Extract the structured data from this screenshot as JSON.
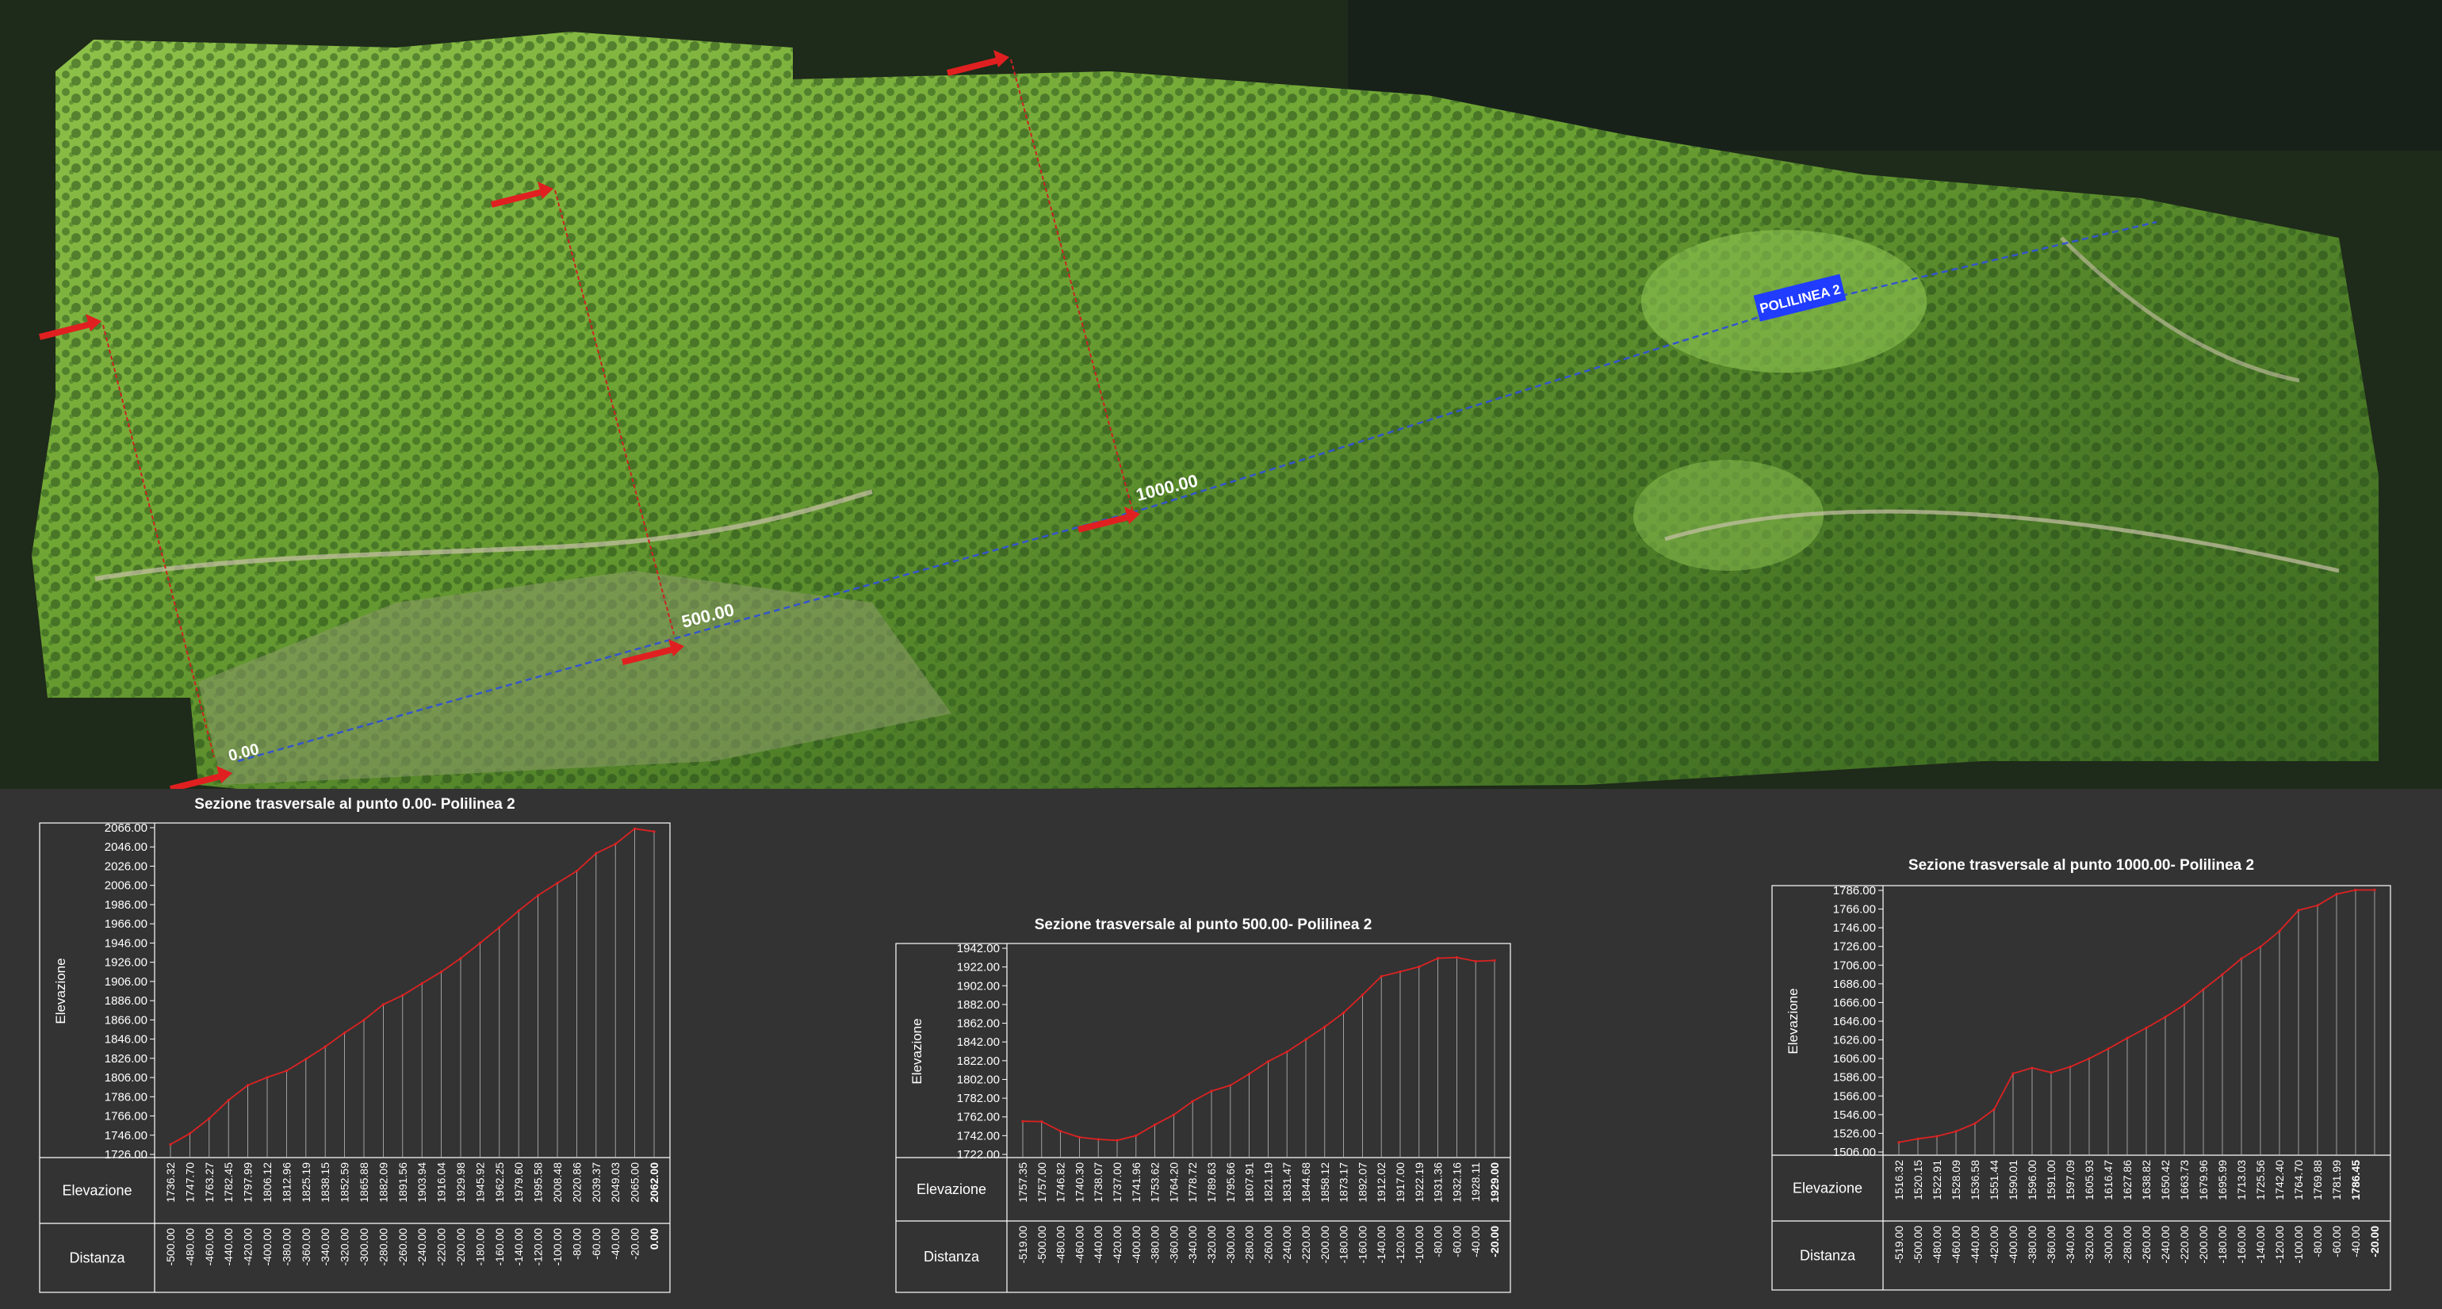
{
  "map": {
    "polyline_label": "POLILINEA 2",
    "station_labels": [
      "0.00",
      "500.00",
      "1000.00"
    ],
    "colors": {
      "background": "#333333",
      "terrain_light": "#7bb33e",
      "terrain_dark": "#2e4d1c",
      "forest_edge": "#1e2a1a",
      "polyline": "#3355cc",
      "label_bg": "#1f3cff",
      "section_line": "#cc2222",
      "arrow": "#e02020"
    }
  },
  "chart_data": [
    {
      "type": "line",
      "title": "Sezione trasversale al punto 0.00- Polilinea 2",
      "ylabel": "Elevazione",
      "row_labels": [
        "Elevazione",
        "Distanza"
      ],
      "ylim": [
        1726,
        2066
      ],
      "yticks": [
        "1726.00",
        "1746.00",
        "1766.00",
        "1786.00",
        "1806.00",
        "1826.00",
        "1846.00",
        "1866.00",
        "1886.00",
        "1906.00",
        "1926.00",
        "1946.00",
        "1966.00",
        "1986.00",
        "2006.00",
        "2026.00",
        "2046.00",
        "2066.00"
      ],
      "x": [
        -500,
        -480,
        -460,
        -440,
        -420,
        -400,
        -380,
        -360,
        -340,
        -320,
        -300,
        -280,
        -260,
        -240,
        -220,
        -200,
        -180,
        -160,
        -140,
        -120,
        -100,
        -80,
        -60,
        -40,
        -20,
        0
      ],
      "values": [
        1736.32,
        1747.7,
        1763.27,
        1782.45,
        1797.99,
        1806.12,
        1812.96,
        1825.19,
        1838.15,
        1852.59,
        1865.88,
        1882.09,
        1891.56,
        1903.94,
        1916.04,
        1929.98,
        1945.92,
        1962.25,
        1979.6,
        1995.58,
        2008.48,
        2020.86,
        2039.37,
        2049.03,
        2065.0,
        2062.0
      ],
      "elev_labels": [
        "1736.32",
        "1747.70",
        "1763.27",
        "1782.45",
        "1797.99",
        "1806.12",
        "1812.96",
        "1825.19",
        "1838.15",
        "1852.59",
        "1865.88",
        "1882.09",
        "1891.56",
        "1903.94",
        "1916.04",
        "1929.98",
        "1945.92",
        "1962.25",
        "1979.60",
        "1995.58",
        "2008.48",
        "2020.86",
        "2039.37",
        "2049.03",
        "2065.00",
        "2062.00"
      ],
      "dist_labels": [
        "-500.00",
        "-480.00",
        "-460.00",
        "-440.00",
        "-420.00",
        "-400.00",
        "-380.00",
        "-360.00",
        "-340.00",
        "-320.00",
        "-300.00",
        "-280.00",
        "-260.00",
        "-240.00",
        "-220.00",
        "-200.00",
        "-180.00",
        "-160.00",
        "-140.00",
        "-120.00",
        "-100.00",
        "-80.00",
        "-60.00",
        "-40.00",
        "-20.00",
        "0.00"
      ]
    },
    {
      "type": "line",
      "title": "Sezione trasversale al punto 500.00- Polilinea 2",
      "ylabel": "Elevazione",
      "row_labels": [
        "Elevazione",
        "Distanza"
      ],
      "ylim": [
        1722,
        1942
      ],
      "yticks": [
        "1722.00",
        "1742.00",
        "1762.00",
        "1782.00",
        "1802.00",
        "1822.00",
        "1842.00",
        "1862.00",
        "1882.00",
        "1902.00",
        "1922.00",
        "1942.00"
      ],
      "x": [
        -519,
        -500,
        -480,
        -460,
        -440,
        -420,
        -400,
        -380,
        -360,
        -340,
        -320,
        -300,
        -280,
        -260,
        -240,
        -220,
        -200,
        -180,
        -160,
        -140,
        -120,
        -100,
        -80,
        -60,
        -40,
        -20
      ],
      "values": [
        1757.35,
        1757.0,
        1746.82,
        1740.3,
        1738.07,
        1737.0,
        1741.96,
        1753.62,
        1764.2,
        1778.72,
        1789.63,
        1795.66,
        1807.91,
        1821.19,
        1831.47,
        1844.68,
        1858.12,
        1873.17,
        1892.07,
        1912.02,
        1917.0,
        1922.19,
        1931.36,
        1932.16,
        1928.11,
        1929.0
      ],
      "elev_labels": [
        "1757.35",
        "1757.00",
        "1746.82",
        "1740.30",
        "1738.07",
        "1737.00",
        "1741.96",
        "1753.62",
        "1764.20",
        "1778.72",
        "1789.63",
        "1795.66",
        "1807.91",
        "1821.19",
        "1831.47",
        "1844.68",
        "1858.12",
        "1873.17",
        "1892.07",
        "1912.02",
        "1917.00",
        "1922.19",
        "1931.36",
        "1932.16",
        "1928.11",
        "1929.00"
      ],
      "dist_labels": [
        "-519.00",
        "-500.00",
        "-480.00",
        "-460.00",
        "-440.00",
        "-420.00",
        "-400.00",
        "-380.00",
        "-360.00",
        "-340.00",
        "-320.00",
        "-300.00",
        "-280.00",
        "-260.00",
        "-240.00",
        "-220.00",
        "-200.00",
        "-180.00",
        "-160.00",
        "-140.00",
        "-120.00",
        "-100.00",
        "-80.00",
        "-60.00",
        "-40.00",
        "-20.00"
      ]
    },
    {
      "type": "line",
      "title": "Sezione trasversale al punto 1000.00- Polilinea 2",
      "ylabel": "Elevazione",
      "row_labels": [
        "Elevazione",
        "Distanza"
      ],
      "ylim": [
        1506,
        1786
      ],
      "yticks": [
        "1506.00",
        "1526.00",
        "1546.00",
        "1566.00",
        "1586.00",
        "1606.00",
        "1626.00",
        "1646.00",
        "1666.00",
        "1686.00",
        "1706.00",
        "1726.00",
        "1746.00",
        "1766.00",
        "1786.00"
      ],
      "x": [
        -519,
        -500,
        -480,
        -460,
        -440,
        -420,
        -400,
        -380,
        -360,
        -340,
        -320,
        -300,
        -280,
        -260,
        -240,
        -220,
        -200,
        -180,
        -160,
        -140,
        -120,
        -100,
        -80,
        -60,
        -40,
        -20
      ],
      "values": [
        1516.32,
        1520.15,
        1522.91,
        1528.09,
        1536.58,
        1551.44,
        1590.01,
        1596.0,
        1591.0,
        1597.09,
        1605.93,
        1616.47,
        1627.86,
        1638.82,
        1650.42,
        1663.73,
        1679.96,
        1695.99,
        1713.03,
        1725.56,
        1742.4,
        1764.7,
        1769.88,
        1781.99,
        1786.45,
        1786.45
      ],
      "elev_labels": [
        "1516.32",
        "1520.15",
        "1522.91",
        "1528.09",
        "1536.58",
        "1551.44",
        "1590.01",
        "1596.00",
        "1591.00",
        "1597.09",
        "1605.93",
        "1616.47",
        "1627.86",
        "1638.82",
        "1650.42",
        "1663.73",
        "1679.96",
        "1695.99",
        "1713.03",
        "1725.56",
        "1742.40",
        "1764.70",
        "1769.88",
        "1781.99",
        "1786.45"
      ],
      "dist_labels": [
        "-519.00",
        "-500.00",
        "-480.00",
        "-460.00",
        "-440.00",
        "-420.00",
        "-400.00",
        "-380.00",
        "-360.00",
        "-340.00",
        "-320.00",
        "-300.00",
        "-280.00",
        "-260.00",
        "-240.00",
        "-220.00",
        "-200.00",
        "-180.00",
        "-160.00",
        "-140.00",
        "-120.00",
        "-100.00",
        "-80.00",
        "-60.00",
        "-40.00",
        "-20.00"
      ]
    }
  ]
}
